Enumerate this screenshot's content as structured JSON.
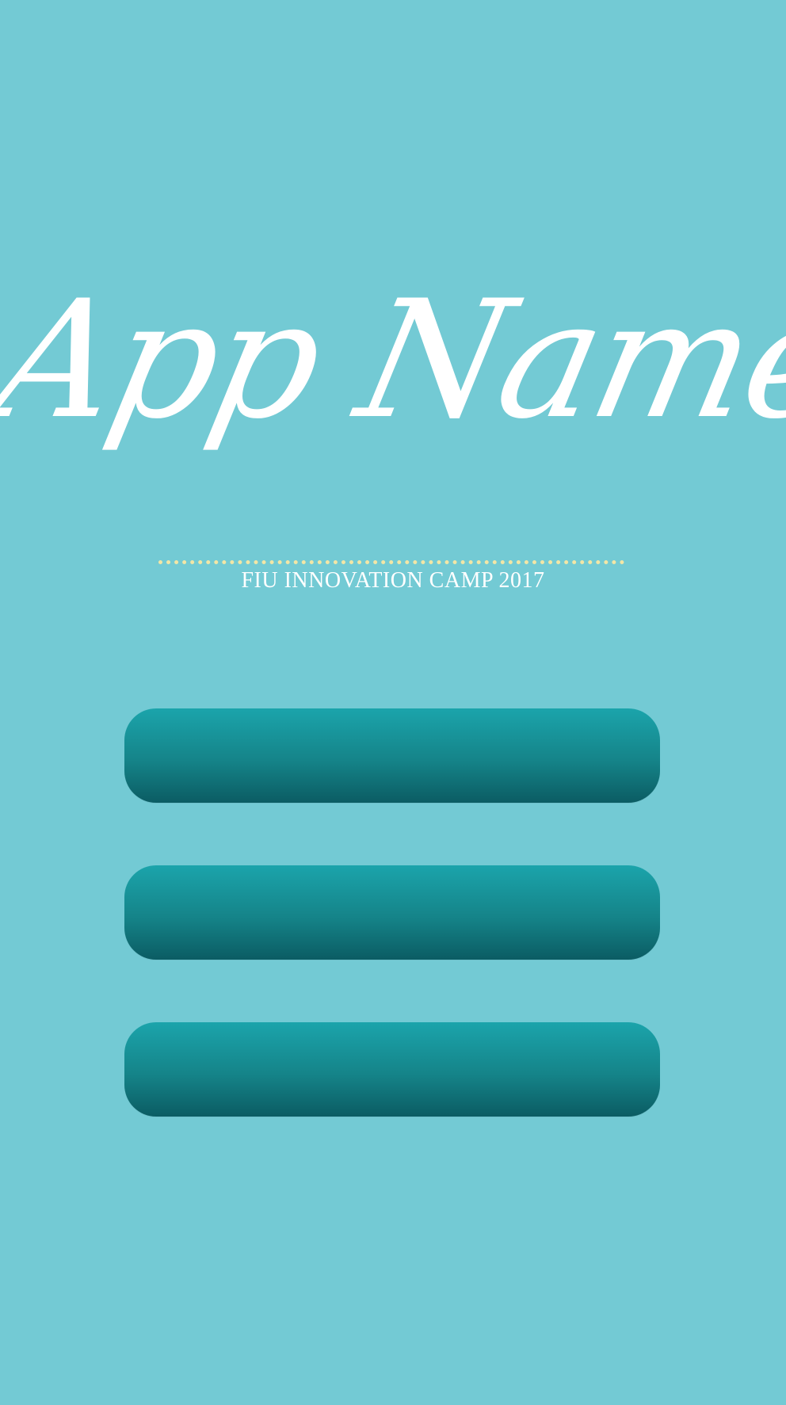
{
  "app": {
    "title": "App Name",
    "subtitle": "FIU INNOVATION CAMP 2017"
  },
  "colors": {
    "background": "#73cad4",
    "button_top": "#1ba4ab",
    "button_bottom": "#0b5c63",
    "divider": "#f2e6a6",
    "text": "#ffffff"
  },
  "menu": {
    "buttons": [
      {
        "label": ""
      },
      {
        "label": ""
      },
      {
        "label": ""
      }
    ]
  }
}
